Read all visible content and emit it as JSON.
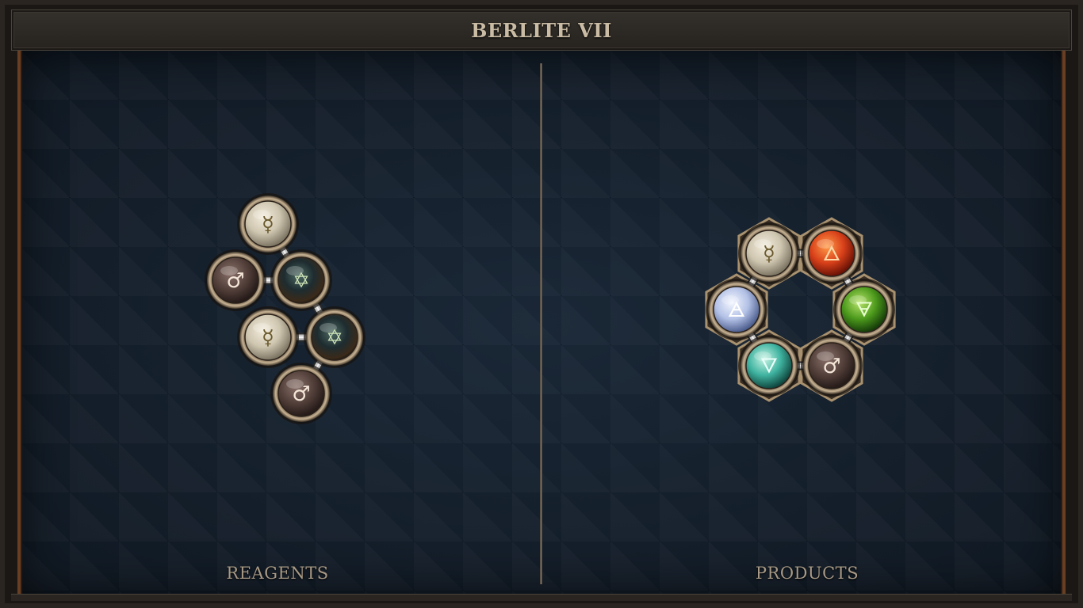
{
  "title": "BERLITE VII",
  "panels": {
    "reagents_label": "REAGENTS",
    "products_label": "PRODUCTS"
  },
  "colors": {
    "salt": "#d9d2bf",
    "iron": "#5a4540",
    "quintessence": "#1f2a2e",
    "fire": "#d9411a",
    "earth": "#4c9a1c",
    "air": "#b9c7e8",
    "water": "#3fb3a0",
    "frame_wood": "#6a3e22"
  },
  "reagents": {
    "atoms": [
      {
        "element": "quicksilver",
        "glyph": "☿"
      },
      {
        "element": "iron",
        "glyph": "♂"
      },
      {
        "element": "quintessence",
        "glyph": "✡"
      },
      {
        "element": "quicksilver",
        "glyph": "☿"
      },
      {
        "element": "quintessence",
        "glyph": "✡"
      },
      {
        "element": "iron",
        "glyph": "♂"
      }
    ]
  },
  "products": {
    "atoms": [
      {
        "element": "quicksilver",
        "glyph": "☿"
      },
      {
        "element": "fire",
        "glyph": "🜂"
      },
      {
        "element": "earth",
        "glyph": "🜃"
      },
      {
        "element": "iron",
        "glyph": "♂"
      },
      {
        "element": "water",
        "glyph": "🜄"
      },
      {
        "element": "air",
        "glyph": "🜁"
      }
    ]
  }
}
